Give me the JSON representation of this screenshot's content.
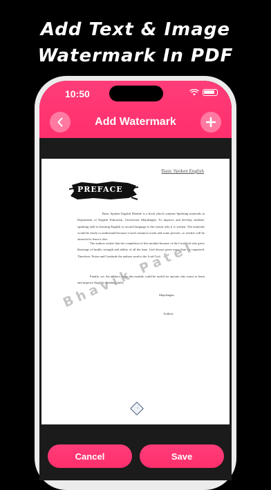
{
  "promo": {
    "line1": "Add Text & Image",
    "line2": "Watermark In PDF"
  },
  "status_bar": {
    "time": "10:50"
  },
  "nav": {
    "title": "Add Watermark",
    "back_icon": "chevron-left-icon",
    "add_icon": "plus-icon"
  },
  "document": {
    "header_link": "Basic Spoken English",
    "heading": "PREFACE",
    "paragraphs": [
      "Basic Spoken English Module is a book which contains Speaking materials in Department of English Education, Universitas Majalengka. To improve and develop students' speaking skill in learning English as second language is the reason why it is written. The materials would be easily to understand because it used common words and some pictures, so readers will be attracted to learn it also.",
      "The authors realize that the completion of this module because of the Lord God who gives blessings of health, strength and ability of all the time. God always gives more than we requested. Therefore, Praise and Gratitude the authors send to the Lord God.",
      "Finally, we, the authors, hope this module could be useful for anyone who wants to learn and improve English speaking skills."
    ],
    "place": "Majalengka",
    "signature": "Authors",
    "watermark_text": "Bhavik Patel",
    "page_number": "i"
  },
  "actions": {
    "cancel_label": "Cancel",
    "save_label": "Save"
  },
  "colors": {
    "accent": "#ff3572",
    "background": "#000000",
    "screen_bg": "#1b1b1b"
  }
}
